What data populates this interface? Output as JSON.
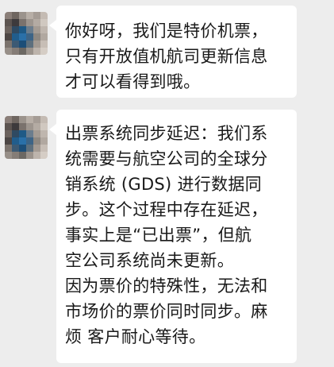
{
  "messages": [
    {
      "sender": "agent",
      "text": "你好呀，我们是特价机票，\n只有开放值机航司更新信息\n才可以看得到哦。"
    },
    {
      "sender": "agent",
      "text": "出票系统同步延迟：我们系\n统需要与航空公司的全球分\n销系统 (GDS) 进行数据同\n步。这个过程中存在延迟，\n事实上是“已出票”，但航\n空公司系统尚未更新。\n因为票价的特殊性，无法和\n市场价的票价同时同步。麻\n烦 客户耐心等待。"
    }
  ],
  "colors": {
    "background": "#ededed",
    "bubble": "#ffffff",
    "text": "#191919"
  }
}
